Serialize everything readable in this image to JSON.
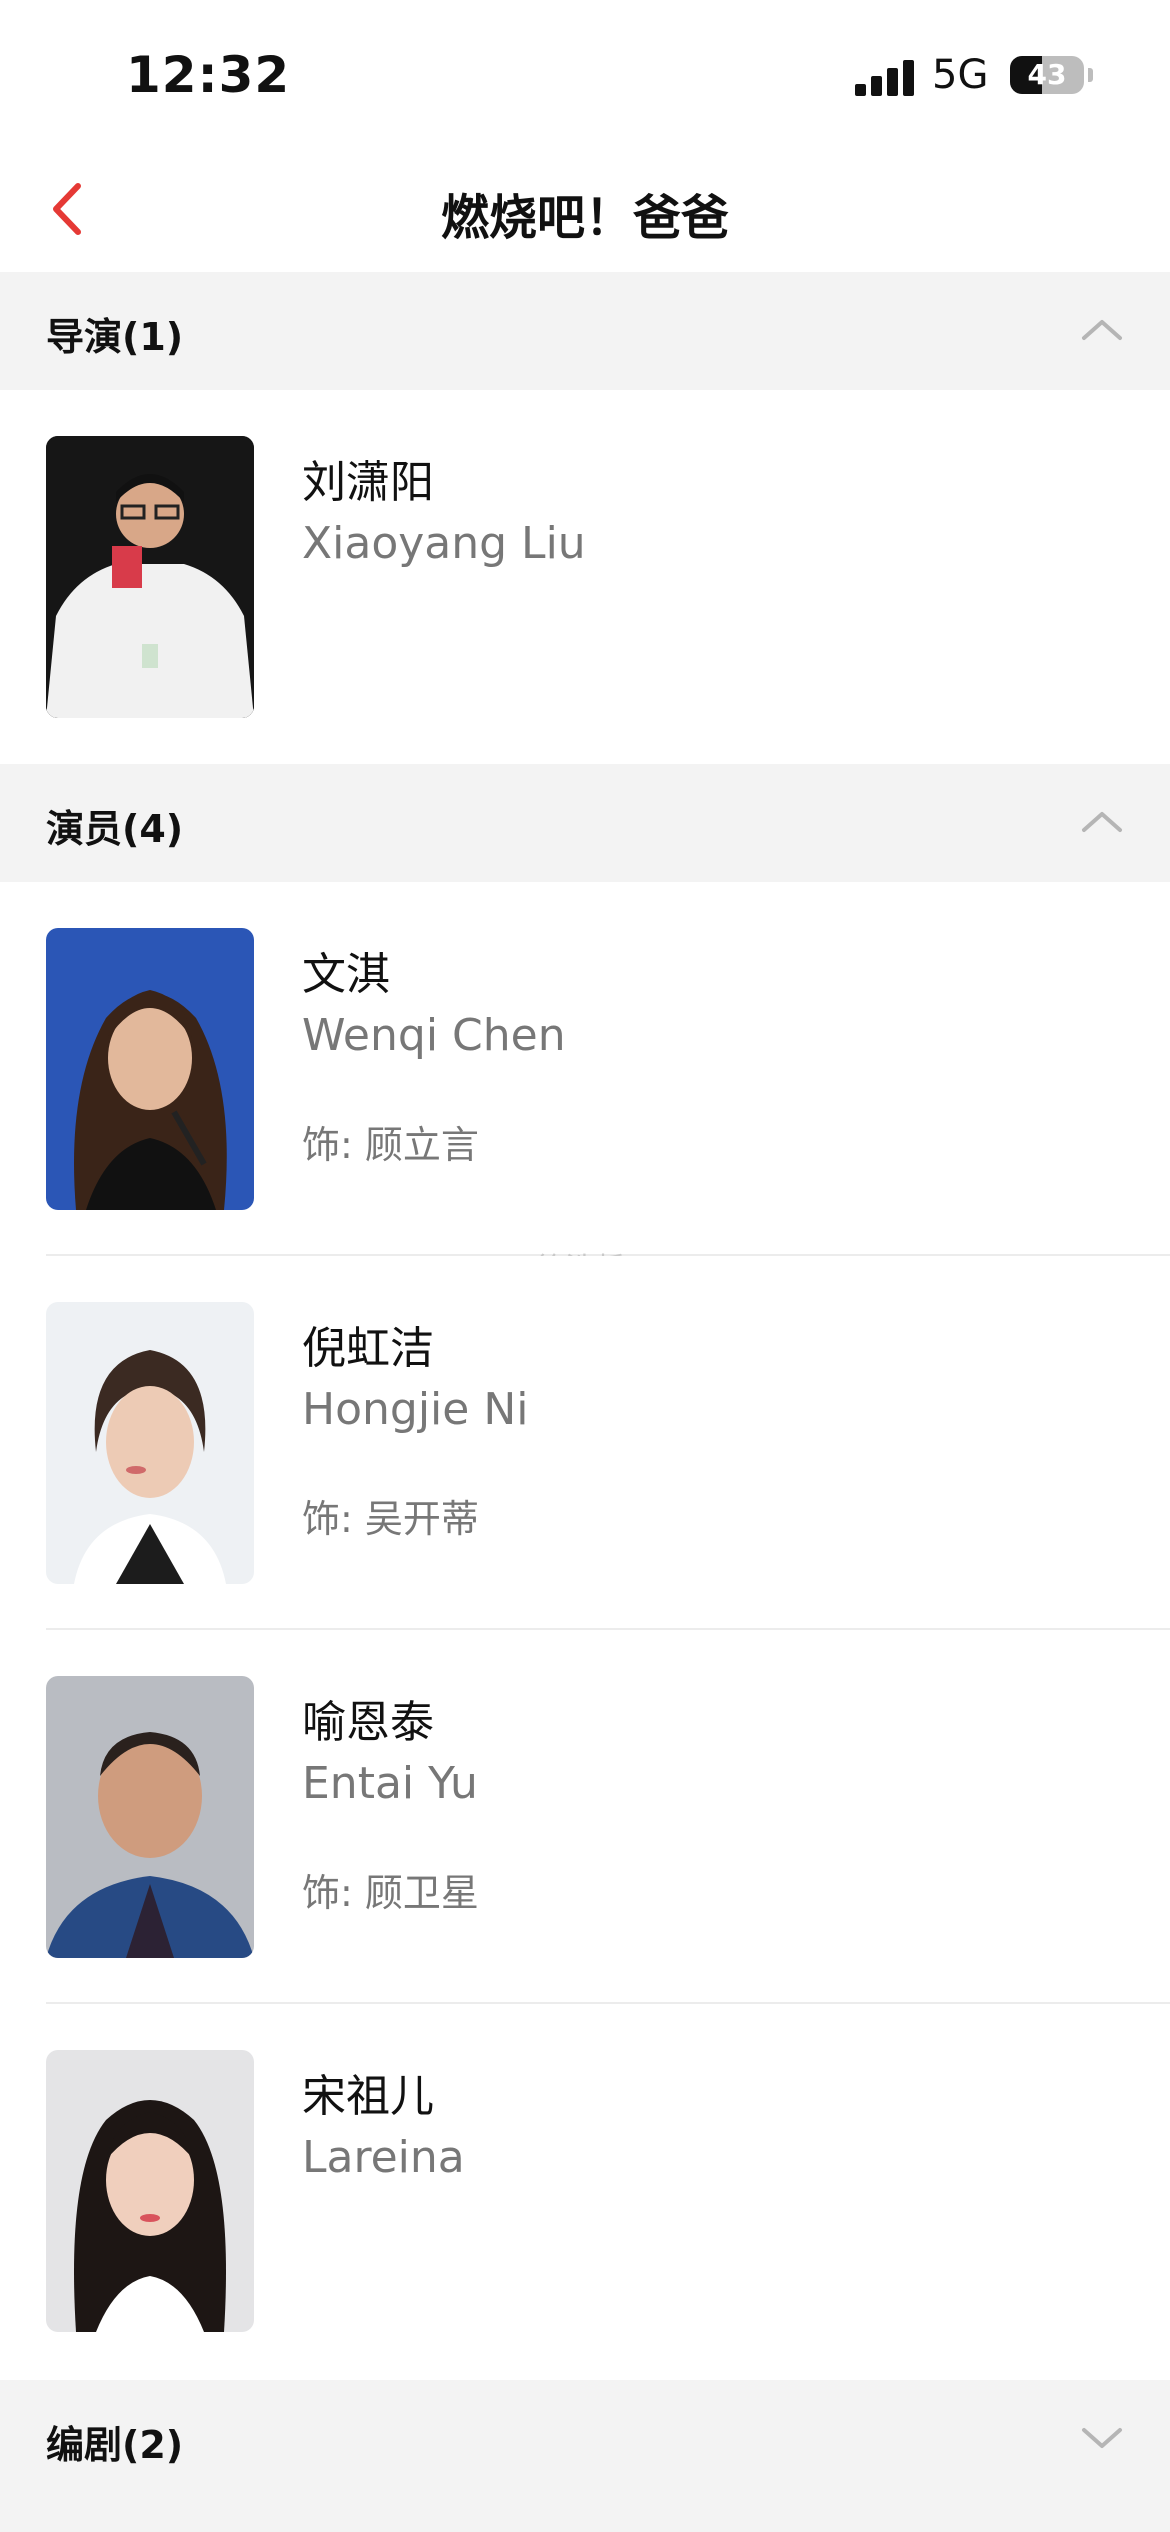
{
  "status": {
    "time": "12:32",
    "network": "5G",
    "battery": "43",
    "battery_level": 0.43
  },
  "header": {
    "title": "燃烧吧！爸爸"
  },
  "sections": {
    "director": {
      "title": "导演(1)"
    },
    "cast": {
      "title": "演员(4)"
    },
    "writer": {
      "title": "编剧(2)"
    }
  },
  "directors": [
    {
      "name_cn": "刘潇阳",
      "name_en": "Xiaoyang Liu"
    }
  ],
  "cast": [
    {
      "name_cn": "文淇",
      "name_en": "Wenqi Chen",
      "role": "饰: 顾立言"
    },
    {
      "name_cn": "倪虹洁",
      "name_en": "Hongjie Ni",
      "role": "饰: 吴开蒂"
    },
    {
      "name_cn": "喻恩泰",
      "name_en": "Entai Yu",
      "role": "饰: 顾卫星"
    },
    {
      "name_cn": "宋祖儿",
      "name_en": "Lareina"
    }
  ],
  "watermark": "@_徐浩哲"
}
